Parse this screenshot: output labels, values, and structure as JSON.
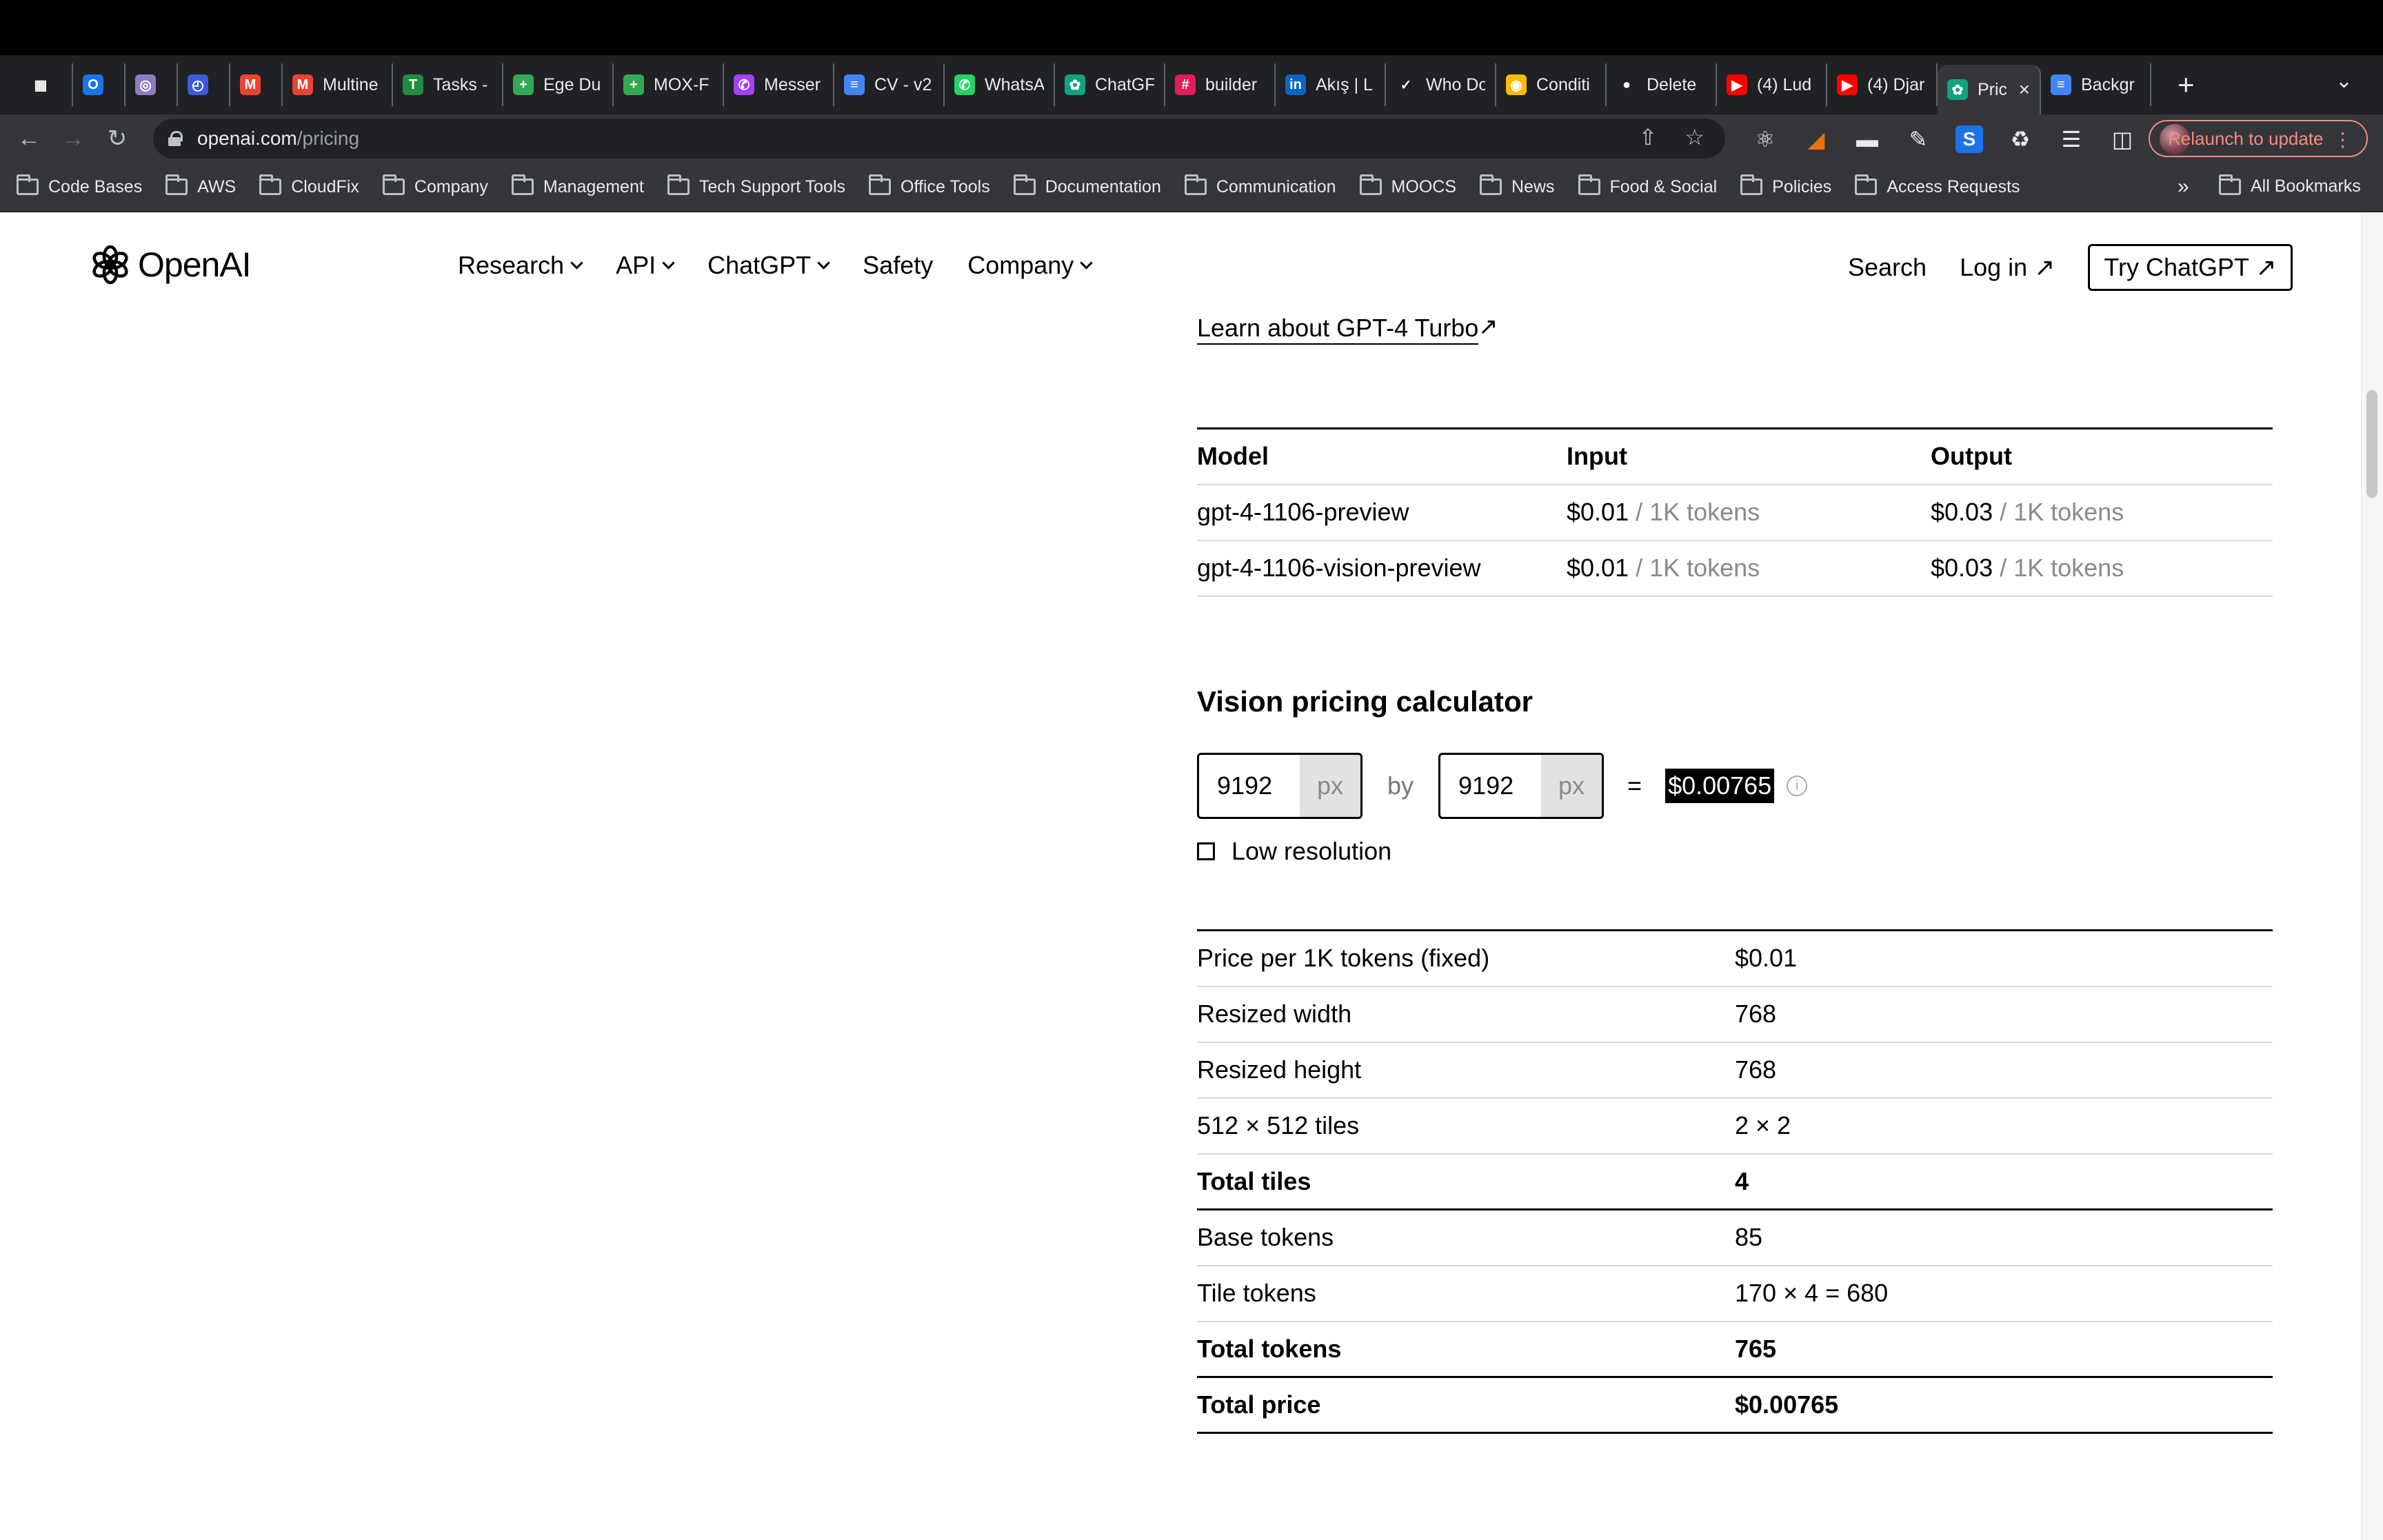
{
  "browser": {
    "tabs": [
      {
        "label": "",
        "icon": "apps-grid-icon",
        "color": "#ffffff"
      },
      {
        "label": "",
        "icon": "outlook-icon",
        "color": "#1a73e8"
      },
      {
        "label": "",
        "icon": "cloud-icon",
        "color": "#8e7cc3"
      },
      {
        "label": "",
        "icon": "timer-icon",
        "color": "#3b5bdb"
      },
      {
        "label": "",
        "icon": "gmail-icon",
        "color": "#ea4335"
      },
      {
        "label": "Multine",
        "icon": "gmail-icon",
        "color": "#ea4335"
      },
      {
        "label": "Tasks -",
        "icon": "tasks-icon",
        "color": "#1e8e3e"
      },
      {
        "label": "Ege Du",
        "icon": "sheets-icon",
        "color": "#34a853"
      },
      {
        "label": "MOX-F",
        "icon": "sheets-icon",
        "color": "#34a853"
      },
      {
        "label": "Messer",
        "icon": "messenger-icon",
        "color": "#a142f4"
      },
      {
        "label": "CV - v2",
        "icon": "docs-icon",
        "color": "#4285f4"
      },
      {
        "label": "WhatsA",
        "icon": "whatsapp-icon",
        "color": "#25d366"
      },
      {
        "label": "ChatGF",
        "icon": "chatgpt-icon",
        "color": "#10a37f"
      },
      {
        "label": "builder",
        "icon": "slack-icon",
        "color": "#e01e5a"
      },
      {
        "label": "Akış | L",
        "icon": "linkedin-icon",
        "color": "#0a66c2"
      },
      {
        "label": "Who Do",
        "icon": "vercel-icon",
        "color": "#ffffff"
      },
      {
        "label": "Conditi",
        "icon": "condition-icon",
        "color": "#fbbc04"
      },
      {
        "label": "Delete",
        "icon": "github-icon",
        "color": "#ffffff"
      },
      {
        "label": "(4) Lud",
        "icon": "youtube-icon",
        "color": "#ff0000"
      },
      {
        "label": "(4) Djar",
        "icon": "youtube-icon",
        "color": "#ff0000"
      },
      {
        "label": "Pric",
        "icon": "openai-icon",
        "color": "#10a37f",
        "active": true
      },
      {
        "label": "Backgr",
        "icon": "docs-icon",
        "color": "#4285f4"
      }
    ],
    "new_tab": "+",
    "url_host": "openai.com",
    "url_path": "/pricing",
    "relaunch_label": "Relaunch to update",
    "bookmarks": [
      "Code Bases",
      "AWS",
      "CloudFix",
      "Company",
      "Management",
      "Tech Support Tools",
      "Office Tools",
      "Documentation",
      "Communication",
      "MOOCS",
      "News",
      "Food & Social",
      "Policies",
      "Access Requests"
    ],
    "bookmarks_more": "»",
    "all_bookmarks": "All Bookmarks"
  },
  "site": {
    "logo_text": "OpenAI",
    "menu": [
      "Research",
      "API",
      "ChatGPT",
      "Safety",
      "Company"
    ],
    "search": "Search",
    "login": "Log in ↗",
    "try": "Try ChatGPT ↗"
  },
  "content": {
    "learn_link": "Learn about GPT-4 Turbo",
    "model_table": {
      "headers": [
        "Model",
        "Input",
        "Output"
      ],
      "rows": [
        {
          "model": "gpt-4-1106-preview",
          "input_price": "$0.01",
          "input_unit": " / 1K tokens",
          "output_price": "$0.03",
          "output_unit": " / 1K tokens"
        },
        {
          "model": "gpt-4-1106-vision-preview",
          "input_price": "$0.01",
          "input_unit": " / 1K tokens",
          "output_price": "$0.03",
          "output_unit": " / 1K tokens"
        }
      ]
    },
    "calculator": {
      "title": "Vision pricing calculator",
      "width": "9192",
      "height": "9192",
      "unit": "px",
      "by": "by",
      "equals": "=",
      "result": "$0.00765",
      "info": "i",
      "low_res_label": "Low resolution",
      "low_res_checked": false
    },
    "details": [
      {
        "label": "Price per 1K tokens (fixed)",
        "value": "$0.01",
        "bold": false
      },
      {
        "label": "Resized width",
        "value": "768",
        "bold": false
      },
      {
        "label": "Resized height",
        "value": "768",
        "bold": false
      },
      {
        "label": "512 × 512 tiles",
        "value": "2 × 2",
        "bold": false
      },
      {
        "label": "Total tiles",
        "value": "4",
        "bold": true
      },
      {
        "label": "Base tokens",
        "value": "85",
        "bold": false
      },
      {
        "label": "Tile tokens",
        "value": "170 × 4 = 680",
        "bold": false
      },
      {
        "label": "Total tokens",
        "value": "765",
        "bold": true
      },
      {
        "label": "Total price",
        "value": "$0.00765",
        "bold": true
      }
    ]
  }
}
